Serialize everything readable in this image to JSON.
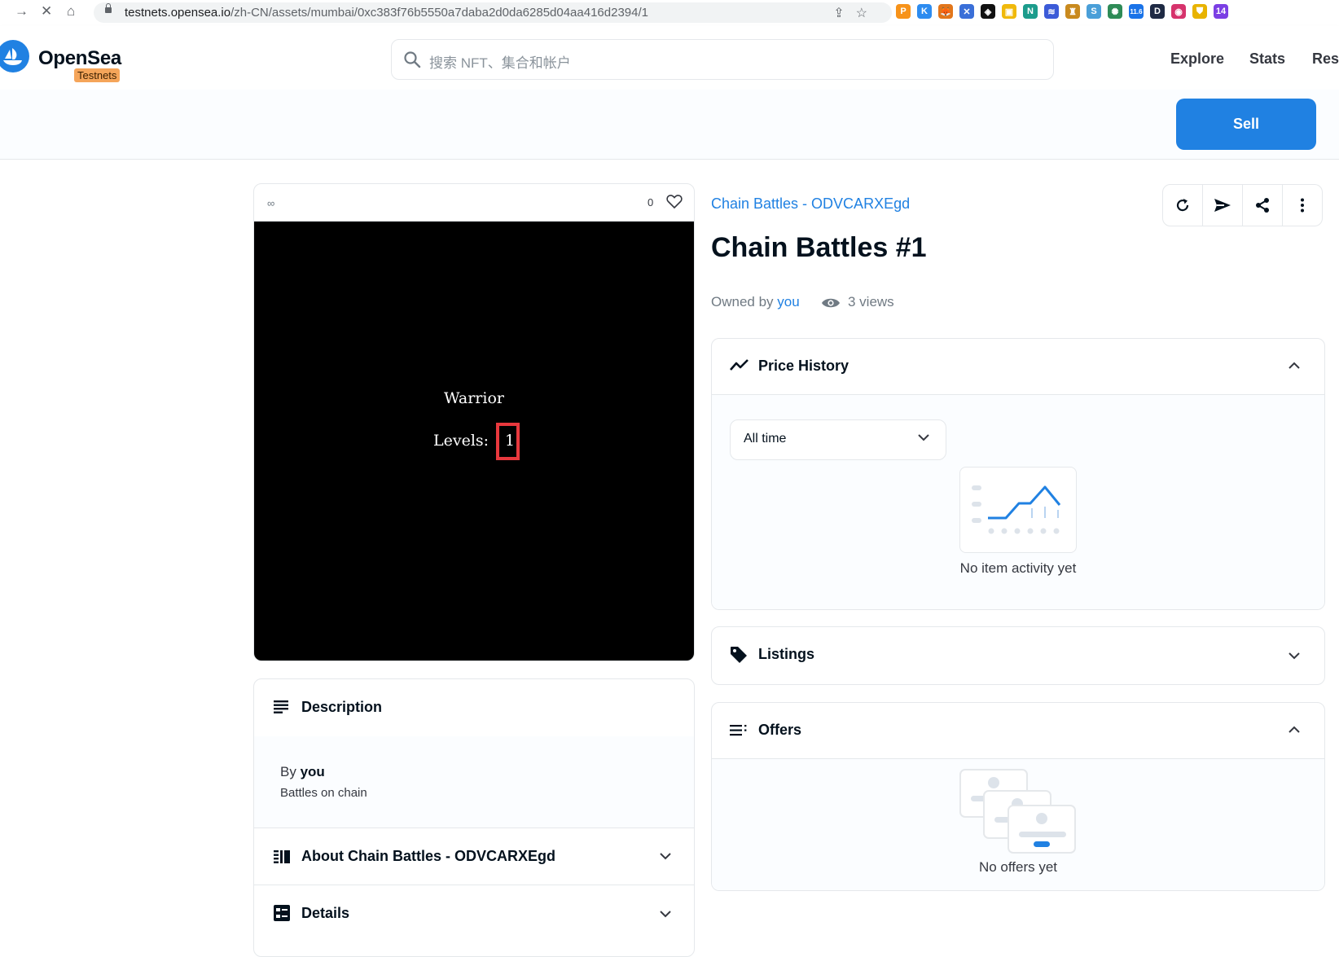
{
  "browser": {
    "url_host": "testnets.opensea.io",
    "url_path": "/zh-CN/assets/mumbai/0xc383f76b5550a7daba2d0da6285d04aa416d2394/1",
    "extensions": [
      {
        "name": "extension-p-icon",
        "label": "P",
        "color": "#f7931a"
      },
      {
        "name": "extension-k-icon",
        "label": "K",
        "color": "#2d8cf0"
      },
      {
        "name": "metamask-icon",
        "label": "🦊",
        "color": "#e2761b"
      },
      {
        "name": "extension-bird-icon",
        "label": "✕",
        "color": "#3a6fd8"
      },
      {
        "name": "extension-dark-icon",
        "label": "◈",
        "color": "#111111"
      },
      {
        "name": "extension-square-icon",
        "label": "▣",
        "color": "#f0b90b"
      },
      {
        "name": "extension-n-icon",
        "label": "N",
        "color": "#1c9c8c"
      },
      {
        "name": "extension-layers-icon",
        "label": "≋",
        "color": "#3c5bd8"
      },
      {
        "name": "extension-lock-icon",
        "label": "♜",
        "color": "#c98a1e"
      },
      {
        "name": "extension-s-icon",
        "label": "S",
        "color": "#4a9fd8"
      },
      {
        "name": "extension-eye-icon",
        "label": "✺",
        "color": "#2e8b57"
      },
      {
        "name": "extension-badge-icon",
        "label": "11.6",
        "color": "#1a73e8"
      },
      {
        "name": "extension-d-icon",
        "label": "D",
        "color": "#1f2a44"
      },
      {
        "name": "extension-circle-icon",
        "label": "◉",
        "color": "#d6336c"
      },
      {
        "name": "extension-shield-icon",
        "label": "⛊",
        "color": "#e8b300"
      },
      {
        "name": "extension-gem-icon",
        "label": "14",
        "color": "#7b3fe4"
      }
    ]
  },
  "header": {
    "logo": "OpenSea",
    "badge": "Testnets",
    "search_placeholder": "搜索 NFT、集合和帐户",
    "nav": [
      "Explore",
      "Stats",
      "Res"
    ]
  },
  "sell_button": "Sell",
  "asset": {
    "favorites": "0",
    "art_name": "Warrior",
    "art_levels_label": "Levels:",
    "art_level_value": "1",
    "collection": "Chain Battles - ODVCARXEgd",
    "title": "Chain Battles #1",
    "owned_by_label": "Owned by",
    "owner": "you",
    "views": "3 views"
  },
  "description": {
    "title": "Description",
    "by_label": "By",
    "by_value": "you",
    "text": "Battles on chain",
    "about_title": "About Chain Battles - ODVCARXEgd",
    "details_title": "Details"
  },
  "price_history": {
    "title": "Price History",
    "range": "All time",
    "empty": "No item activity yet"
  },
  "listings": {
    "title": "Listings"
  },
  "offers": {
    "title": "Offers",
    "empty": "No offers yet"
  },
  "colors": {
    "accent": "#2081e2",
    "highlight": "#e8383d",
    "badge": "#f5a55a"
  }
}
